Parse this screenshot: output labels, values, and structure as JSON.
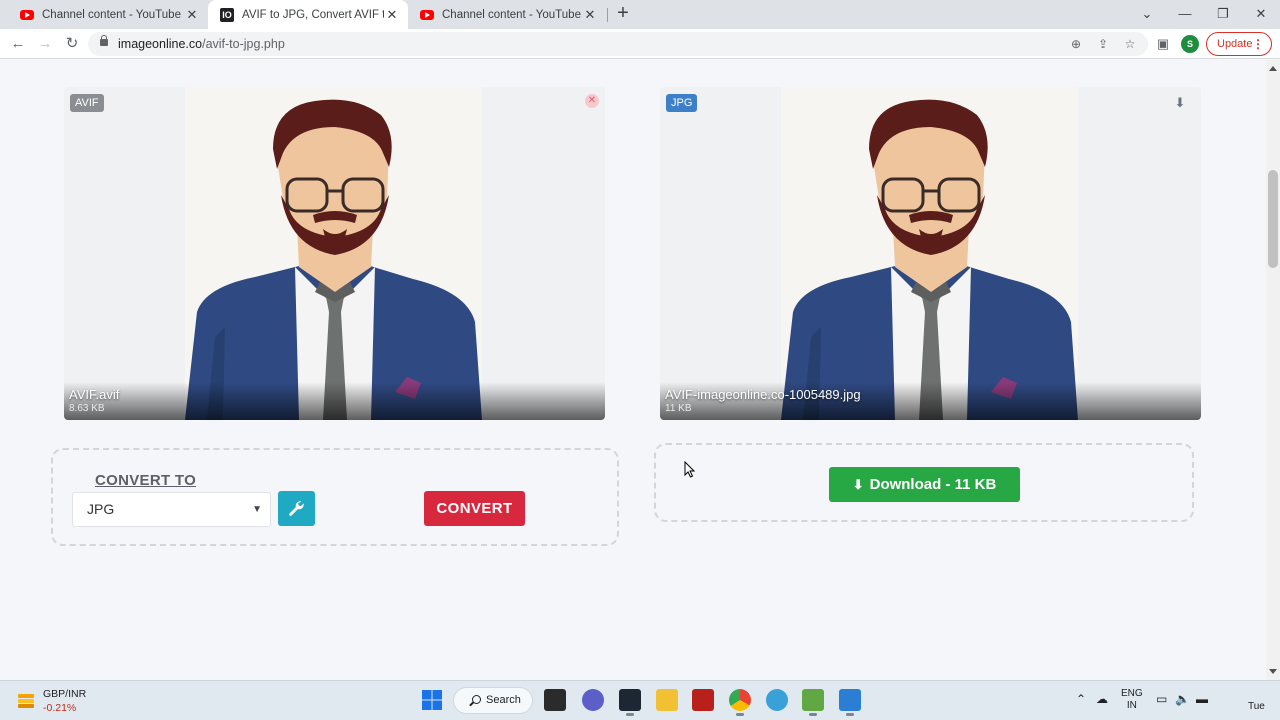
{
  "browser": {
    "tabs": [
      {
        "title": "Channel content - YouTube Studio",
        "icon": "youtube-icon",
        "active": false
      },
      {
        "title": "AVIF to JPG, Convert AVIF to JPG",
        "icon": "imageonline-icon",
        "active": true
      },
      {
        "title": "Channel content - YouTube Studio",
        "icon": "youtube-icon",
        "active": false
      }
    ],
    "url_host": "imageonline.co",
    "url_path": "/avif-to-jpg.php",
    "profile_initial": "S",
    "update_label": "Update"
  },
  "source": {
    "badge": "AVIF",
    "filename": "AVIF.avif",
    "filesize": "8.63 KB"
  },
  "result": {
    "badge": "JPG",
    "filename": "AVIF-imageonline.co-1005489.jpg",
    "filesize": "11 KB"
  },
  "converter": {
    "convert_to_label": "CONVERT TO",
    "selected_format": "JPG",
    "convert_label": "CONVERT"
  },
  "download": {
    "label": "Download - 11 KB"
  },
  "taskbar": {
    "ticker_pair": "GBP/INR",
    "ticker_change": "-0.21%",
    "search_label": "Search",
    "lang_primary": "ENG",
    "lang_secondary": "IN",
    "day": "Tue"
  },
  "colors": {
    "convert_button": "#d8283e",
    "download_button": "#28a745",
    "wrench_button": "#1fa9c3",
    "jpg_badge": "#3e7fc9",
    "avif_badge": "#8a8d91"
  }
}
